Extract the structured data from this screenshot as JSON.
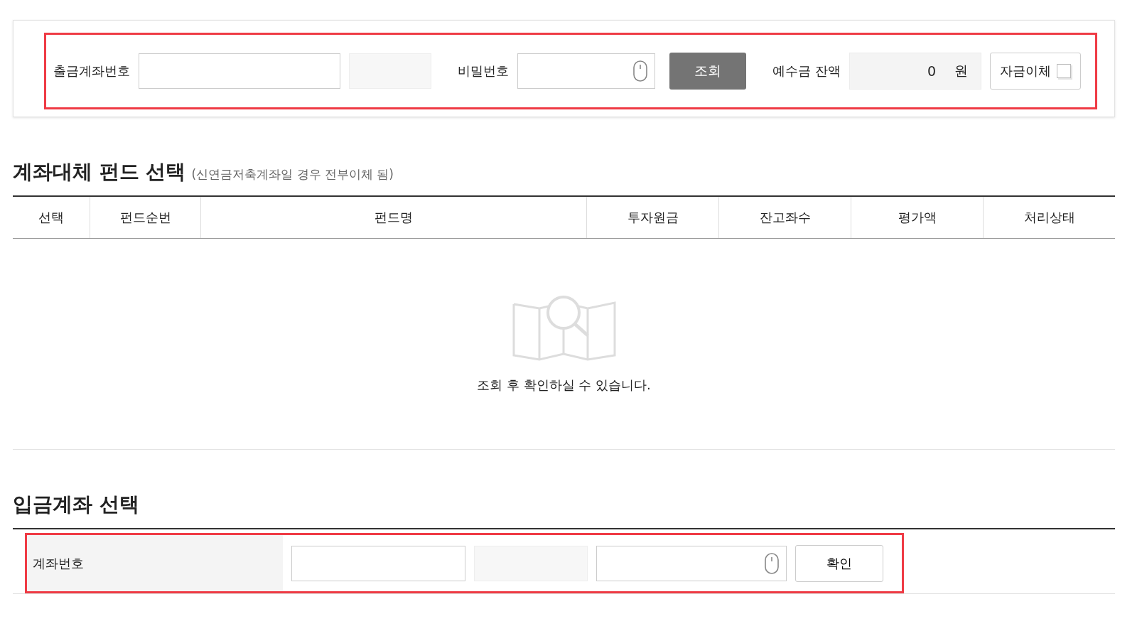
{
  "search_bar": {
    "highlighted": true,
    "account_label": "출금계좌번호",
    "password_label": "비밀번호",
    "query_button": "조회",
    "balance_label": "예수금 잔액",
    "balance_value": "0",
    "balance_unit": "원",
    "transfer_label": "자금이체",
    "transfer_checked": false
  },
  "fund_section": {
    "title": "계좌대체 펀드 선택",
    "note": "(신연금저축계좌일 경우 전부이체 됨)",
    "columns": [
      "선택",
      "펀드순번",
      "펀드명",
      "투자원금",
      "잔고좌수",
      "평가액",
      "처리상태"
    ],
    "empty_message": "조회 후 확인하실 수 있습니다."
  },
  "deposit_section": {
    "title": "입금계좌 선택",
    "highlighted": true,
    "account_label": "계좌번호",
    "confirm_button": "확인"
  }
}
